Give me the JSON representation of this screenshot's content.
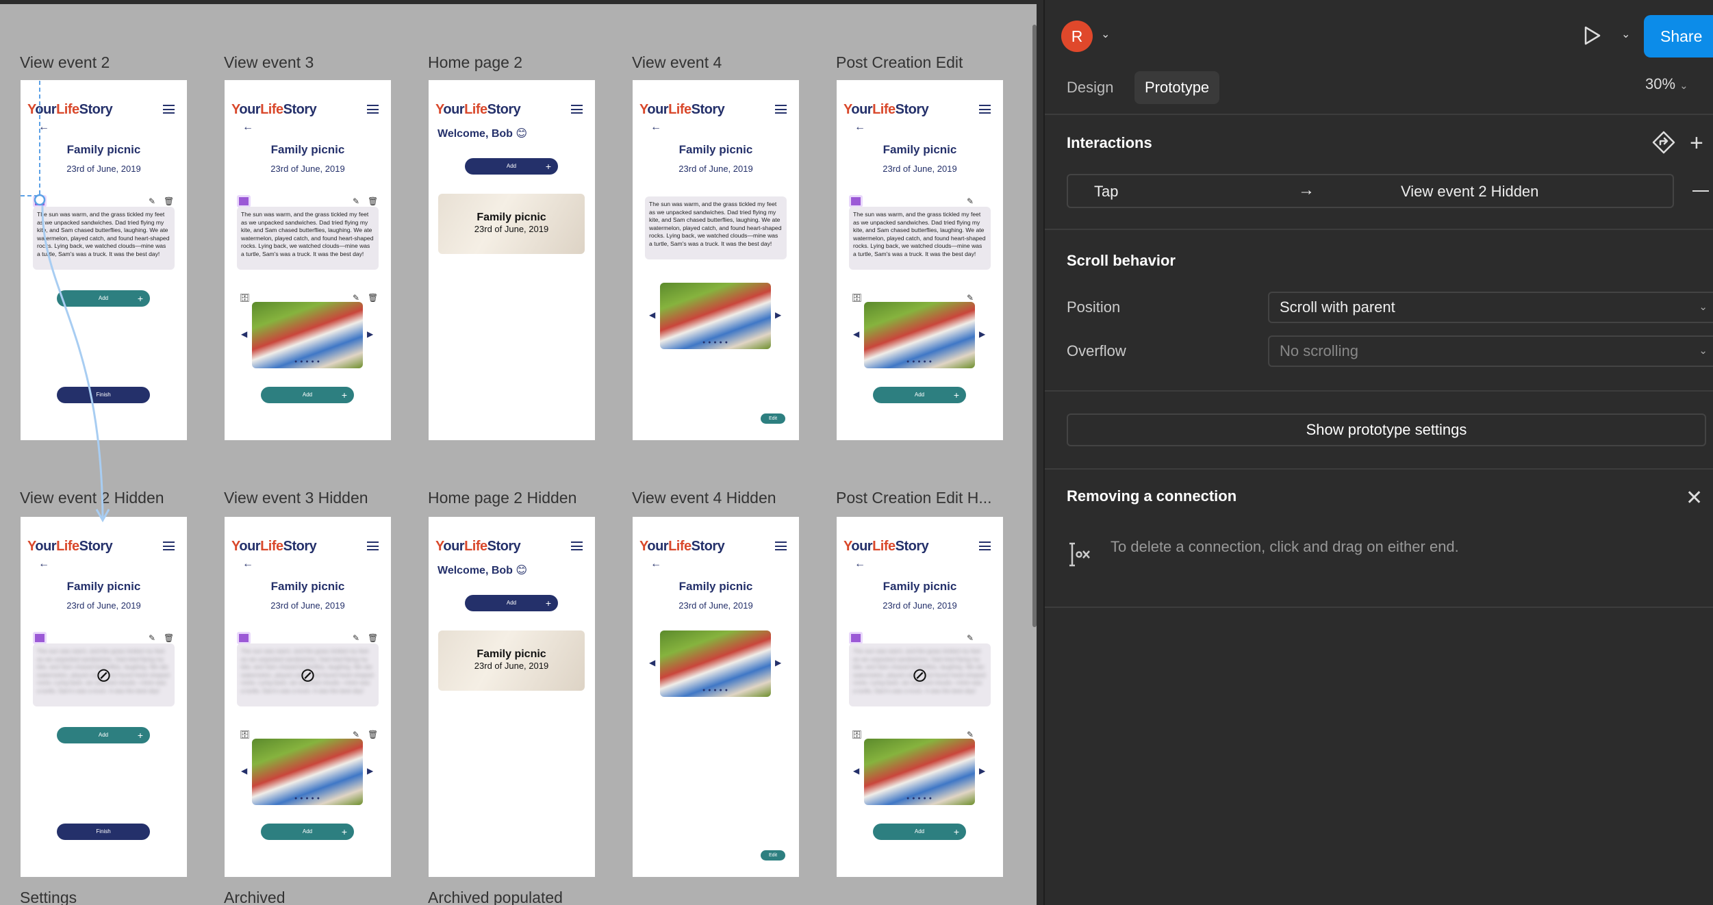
{
  "header": {
    "avatar_initial": "R",
    "share_label": "Share",
    "tabs": [
      {
        "label": "Design"
      },
      {
        "label": "Prototype"
      }
    ],
    "zoom": "30%"
  },
  "panel": {
    "interactions_title": "Interactions",
    "interaction": {
      "trigger": "Tap",
      "arrow": "→",
      "destination": "View event 2 Hidden"
    },
    "scroll_title": "Scroll behavior",
    "position_label": "Position",
    "position_value": "Scroll with parent",
    "overflow_label": "Overflow",
    "overflow_value": "No scrolling",
    "proto_settings_label": "Show prototype settings",
    "removing_title": "Removing a connection",
    "removing_hint": "To delete a connection, click and drag on either end."
  },
  "frames": {
    "row1": [
      "View event 2",
      "View event 3",
      "Home page 2",
      "View event 4",
      "Post Creation Edit"
    ],
    "row2": [
      "View event 2 Hidden",
      "View event 3 Hidden",
      "Home page 2 Hidden",
      "View event 4 Hidden",
      "Post Creation Edit H..."
    ],
    "row3": [
      "Settings",
      "Archived",
      "Archived populated"
    ]
  },
  "mock": {
    "logo_y": "Y",
    "logo_our": "our",
    "logo_life": "Life",
    "logo_story": "Story",
    "event_title": "Family picnic",
    "event_date": "23rd of June, 2019",
    "story": "The sun was warm, and the grass tickled my feet as we unpacked sandwiches. Dad tried flying my kite, and Sam chased butterflies, laughing. We ate watermelon, played catch, and found heart-shaped rocks. Lying back, we watched clouds—mine was a turtle, Sam's was a truck. It was the best day!",
    "add_label": "Add",
    "finish_label": "Finish",
    "edit_label": "Edit",
    "welcome": "Welcome, Bob 😊",
    "card_title": "Family picnic",
    "card_date": "23rd of June, 2019"
  },
  "colors": {
    "accent": "#0c8ce9",
    "navy": "#24306a",
    "teal": "#2d7f80",
    "purple": "#9b59d6",
    "logo_red": "#d9482b"
  }
}
